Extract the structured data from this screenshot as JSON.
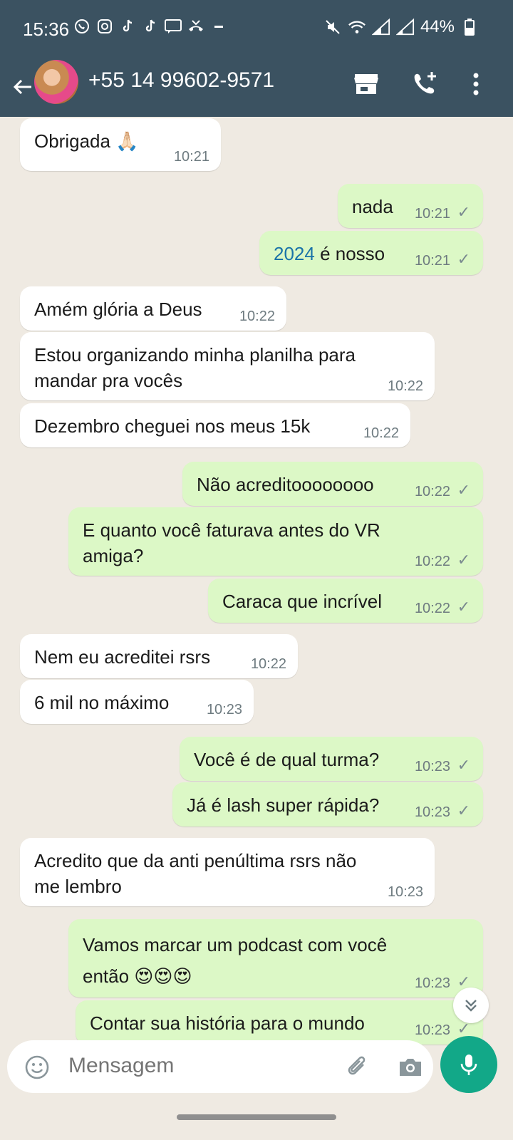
{
  "status_bar": {
    "time": "15:36",
    "battery": "44%",
    "notification_icons": [
      "whatsapp-icon",
      "instagram-icon",
      "tiktok-icon",
      "tiktok-icon",
      "chat-icon",
      "missed-call-icon",
      "more-icon"
    ],
    "system_icons": [
      "mute-icon",
      "wifi-icon",
      "signal-icon",
      "signal-icon",
      "battery-icon"
    ]
  },
  "header": {
    "contact": "+55 14 99602-9571"
  },
  "messages": [
    {
      "dir": "in",
      "text": "Obrigada 🙏🏻",
      "time": "10:21"
    },
    {
      "dir": "out",
      "text": "nada",
      "time": "10:21"
    },
    {
      "dir": "out",
      "link": "2024",
      "text": " é nosso",
      "time": "10:21"
    },
    {
      "dir": "in",
      "text": "Amém glória a Deus",
      "time": "10:22"
    },
    {
      "dir": "in",
      "text": "Estou organizando minha planilha para\nmandar pra vocês",
      "time": "10:22"
    },
    {
      "dir": "in",
      "text": "Dezembro cheguei nos meus 15k",
      "time": "10:22"
    },
    {
      "dir": "out",
      "text": "Não acreditoooooooo",
      "time": "10:22"
    },
    {
      "dir": "out",
      "text": "E quanto você faturava antes do VR\namiga?",
      "time": "10:22"
    },
    {
      "dir": "out",
      "text": "Caraca que incrível",
      "time": "10:22"
    },
    {
      "dir": "in",
      "text": "Nem eu acreditei rsrs",
      "time": "10:22"
    },
    {
      "dir": "in",
      "text": "6 mil no máximo",
      "time": "10:23"
    },
    {
      "dir": "out",
      "text": "Você é de qual turma?",
      "time": "10:23"
    },
    {
      "dir": "out",
      "text": "Já é lash super rápida?",
      "time": "10:23"
    },
    {
      "dir": "in",
      "text": "Acredito que da anti penúltima rsrs não\nme lembro",
      "time": "10:23"
    },
    {
      "dir": "out",
      "text": "Vamos marcar um podcast com você\nentão 😍😍😍",
      "time": "10:23"
    },
    {
      "dir": "out",
      "text": "Contar sua história para o mundo",
      "time": "10:23"
    }
  ],
  "tick": "✓",
  "composer": {
    "placeholder": "Mensagem"
  },
  "colors": {
    "header": "#3b5261",
    "outgoing": "#dcf8c6",
    "incoming": "#ffffff",
    "wallpaper": "#efeae2",
    "accent": "#12a888"
  }
}
